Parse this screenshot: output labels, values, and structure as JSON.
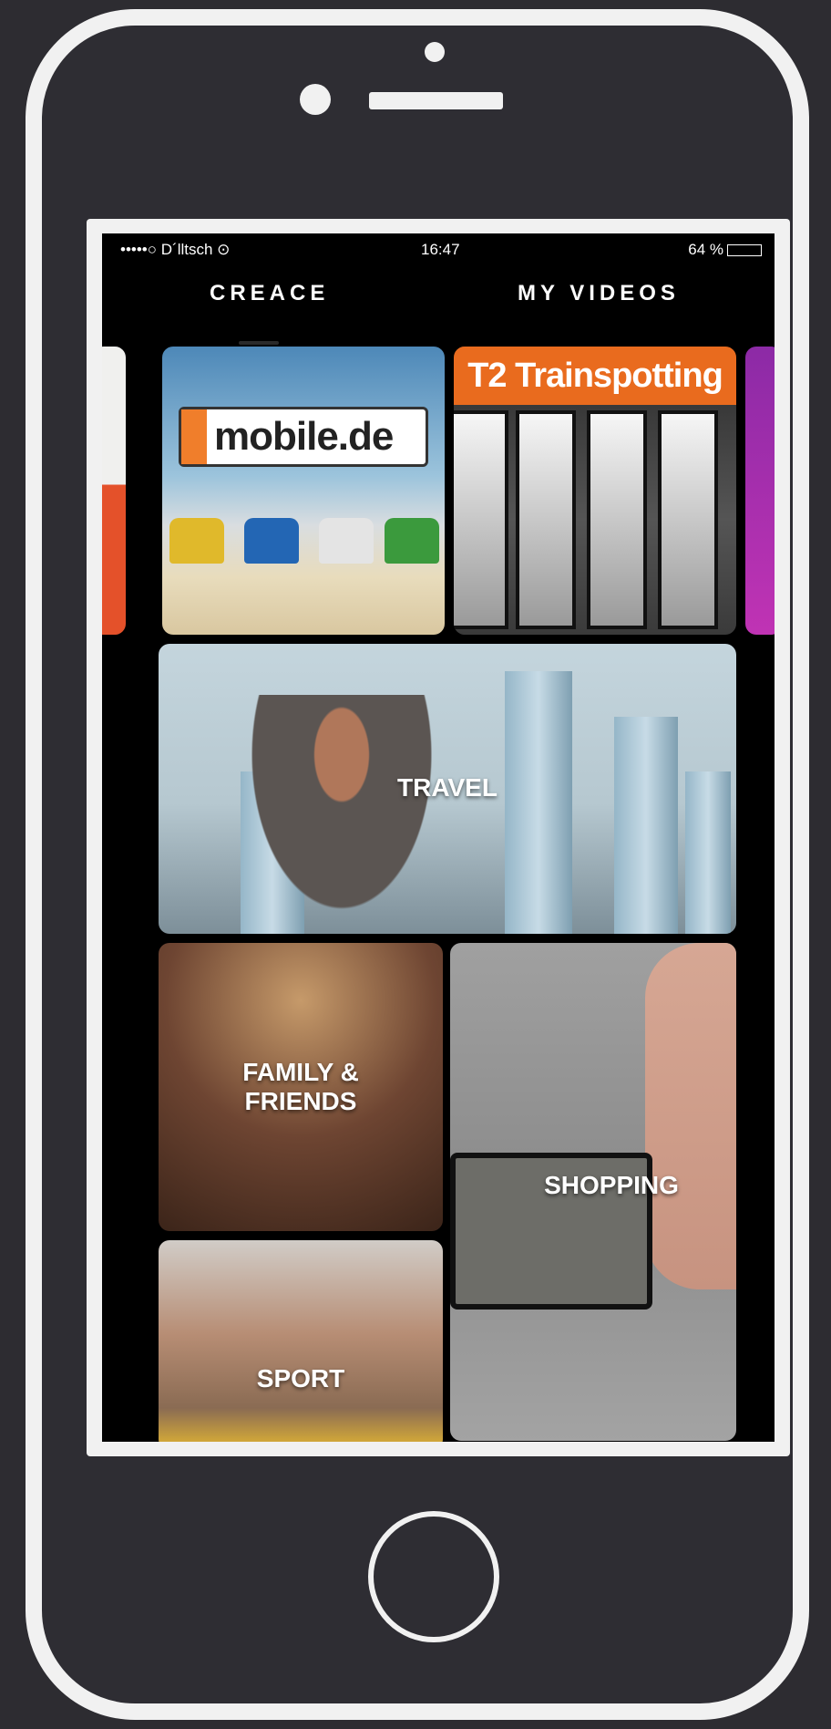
{
  "status_bar": {
    "carrier": "•••••○ D´lltsch ⊙",
    "time": "16:47",
    "battery": "64 %"
  },
  "tabs": [
    {
      "label": "CREACE"
    },
    {
      "label": "MY VIDEOS"
    }
  ],
  "tiles": {
    "mobilede_logo": "mobile.de",
    "t2_title": "T2 Trainspotting",
    "travel": "TRAVEL",
    "family": "FAMILY &\nFRIENDS",
    "shopping": "SHOPPING",
    "sport": "SPORT"
  },
  "colors": {
    "phone_body": "#f1f1f1",
    "background": "#2d2c31",
    "accent_orange": "#e96b1e"
  }
}
